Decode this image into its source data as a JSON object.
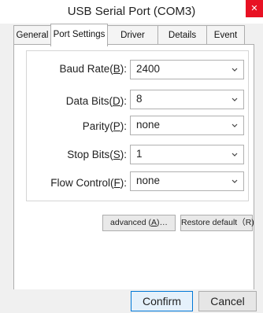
{
  "window": {
    "title": "USB Serial Port (COM3)",
    "close_glyph": "✕"
  },
  "tabs": [
    {
      "label": "General"
    },
    {
      "label": "Port Settings"
    },
    {
      "label": "Driver"
    },
    {
      "label": "Details"
    },
    {
      "label": "Event"
    }
  ],
  "settings": {
    "baud_rate": {
      "label_pre": "Baud Rate(",
      "key": "B",
      "label_post": "):",
      "value": "2400"
    },
    "data_bits": {
      "label_pre": "Data Bits(",
      "key": "D",
      "label_post": "):",
      "value": "8"
    },
    "parity": {
      "label_pre": "Parity(",
      "key": "P",
      "label_post": "):",
      "value": "none"
    },
    "stop_bits": {
      "label_pre": "Stop Bits(",
      "key": "S",
      "label_post": "):",
      "value": "1"
    },
    "flow_control": {
      "label_pre": "Flow Control(",
      "key": "F",
      "label_post": "):",
      "value": "none"
    }
  },
  "buttons": {
    "advanced_pre": "advanced (",
    "advanced_key": "A",
    "advanced_post": ")…",
    "restore_default": "Restore default（R)",
    "confirm": "Confirm",
    "cancel": "Cancel"
  },
  "icons": {
    "dropdown": "chevron-down-icon",
    "close": "close-icon"
  },
  "colors": {
    "close_button": "#e81123",
    "focus_border": "#0078d7"
  }
}
